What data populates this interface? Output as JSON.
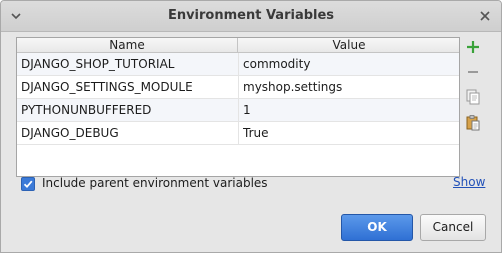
{
  "window": {
    "title": "Environment Variables"
  },
  "table": {
    "columns": [
      "Name",
      "Value"
    ],
    "rows": [
      {
        "name": "DJANGO_SHOP_TUTORIAL",
        "value": "commodity"
      },
      {
        "name": "DJANGO_SETTINGS_MODULE",
        "value": "myshop.settings"
      },
      {
        "name": "PYTHONUNBUFFERED",
        "value": "1"
      },
      {
        "name": "DJANGO_DEBUG",
        "value": "True"
      }
    ]
  },
  "toolbar": {
    "icons": [
      "add-icon",
      "remove-icon",
      "copy-icon",
      "paste-icon"
    ],
    "add_color": "#3aa23a"
  },
  "options": {
    "include_parent_label": "Include parent environment variables",
    "include_parent_checked": true,
    "show_link": "Show"
  },
  "buttons": {
    "ok": "OK",
    "cancel": "Cancel"
  },
  "colors": {
    "accent": "#3b7ad8",
    "link": "#2251b8"
  }
}
